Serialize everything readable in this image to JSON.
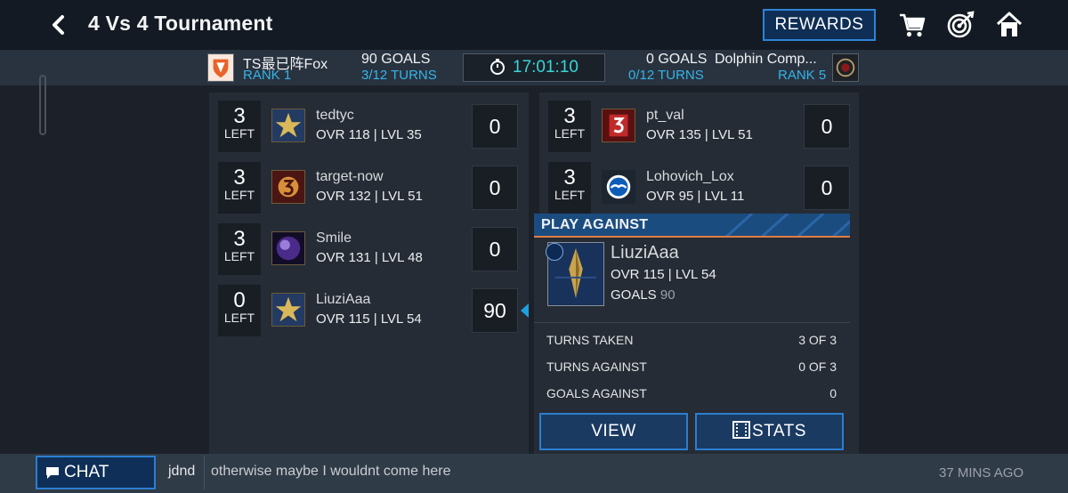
{
  "header": {
    "title": "4 Vs 4 Tournament",
    "rewards_label": "REWARDS",
    "icons": [
      "back-chevron-icon",
      "cart-icon",
      "target-icon",
      "home-icon"
    ]
  },
  "scorebar": {
    "left_team": {
      "name": "TS最已阵Fox",
      "rank": "RANK 1"
    },
    "left_goals": "90 GOALS",
    "left_turns": "3/12 TURNS",
    "timer": "17:01:10",
    "right_goals": "0 GOALS",
    "right_turns": "0/12 TURNS",
    "right_team": {
      "name": "Dolphin Comp...",
      "rank": "RANK 5"
    }
  },
  "left_players": [
    {
      "left_num": "3",
      "left_label": "LEFT",
      "name": "tedtyc",
      "stats": "OVR 118 | LVL 35",
      "goals": "0",
      "avatar": "gold-star-shield-icon"
    },
    {
      "left_num": "3",
      "left_label": "LEFT",
      "name": "target-now",
      "stats": "OVR 132 | LVL 51",
      "goals": "0",
      "avatar": "number-3-crest-icon"
    },
    {
      "left_num": "3",
      "left_label": "LEFT",
      "name": "Smile",
      "stats": "OVR 131 | LVL 48",
      "goals": "0",
      "avatar": "purple-orb-icon"
    },
    {
      "left_num": "0",
      "left_label": "LEFT",
      "name": "LiuziAaa",
      "stats": "OVR 115 | LVL 54",
      "goals": "90",
      "avatar": "gold-star-shield-icon"
    }
  ],
  "right_players": [
    {
      "left_num": "3",
      "left_label": "LEFT",
      "name": "pt_val",
      "stats": "OVR 135 | LVL 51",
      "goals": "0",
      "avatar": "red-number-3-icon"
    },
    {
      "left_num": "3",
      "left_label": "LEFT",
      "name": "Lohovich_Lox",
      "stats": "OVR 95 | LVL 11",
      "goals": "0",
      "avatar": "blue-seagull-crest-icon"
    }
  ],
  "play_against": {
    "title": "PLAY AGAINST",
    "name": "LiuziAaa",
    "stats": "OVR 115 | LVL 54",
    "goals_label": "GOALS",
    "goals_value": "90",
    "lines": [
      {
        "label": "TURNS TAKEN",
        "value": "3 OF 3"
      },
      {
        "label": "TURNS AGAINST",
        "value": "0 OF 3"
      },
      {
        "label": "GOALS AGAINST",
        "value": "0"
      }
    ],
    "view_label": "VIEW",
    "stats_label": "STATS"
  },
  "chat": {
    "button_label": "CHAT",
    "user": "jdnd",
    "message": "otherwise maybe I wouldnt come here",
    "time": "37 MINS AGO"
  },
  "colors": {
    "accent_blue": "#2c7ed0",
    "rank_cyan": "#34b4ea",
    "timer_cyan": "#38d6d9",
    "orange": "#e07b45"
  }
}
